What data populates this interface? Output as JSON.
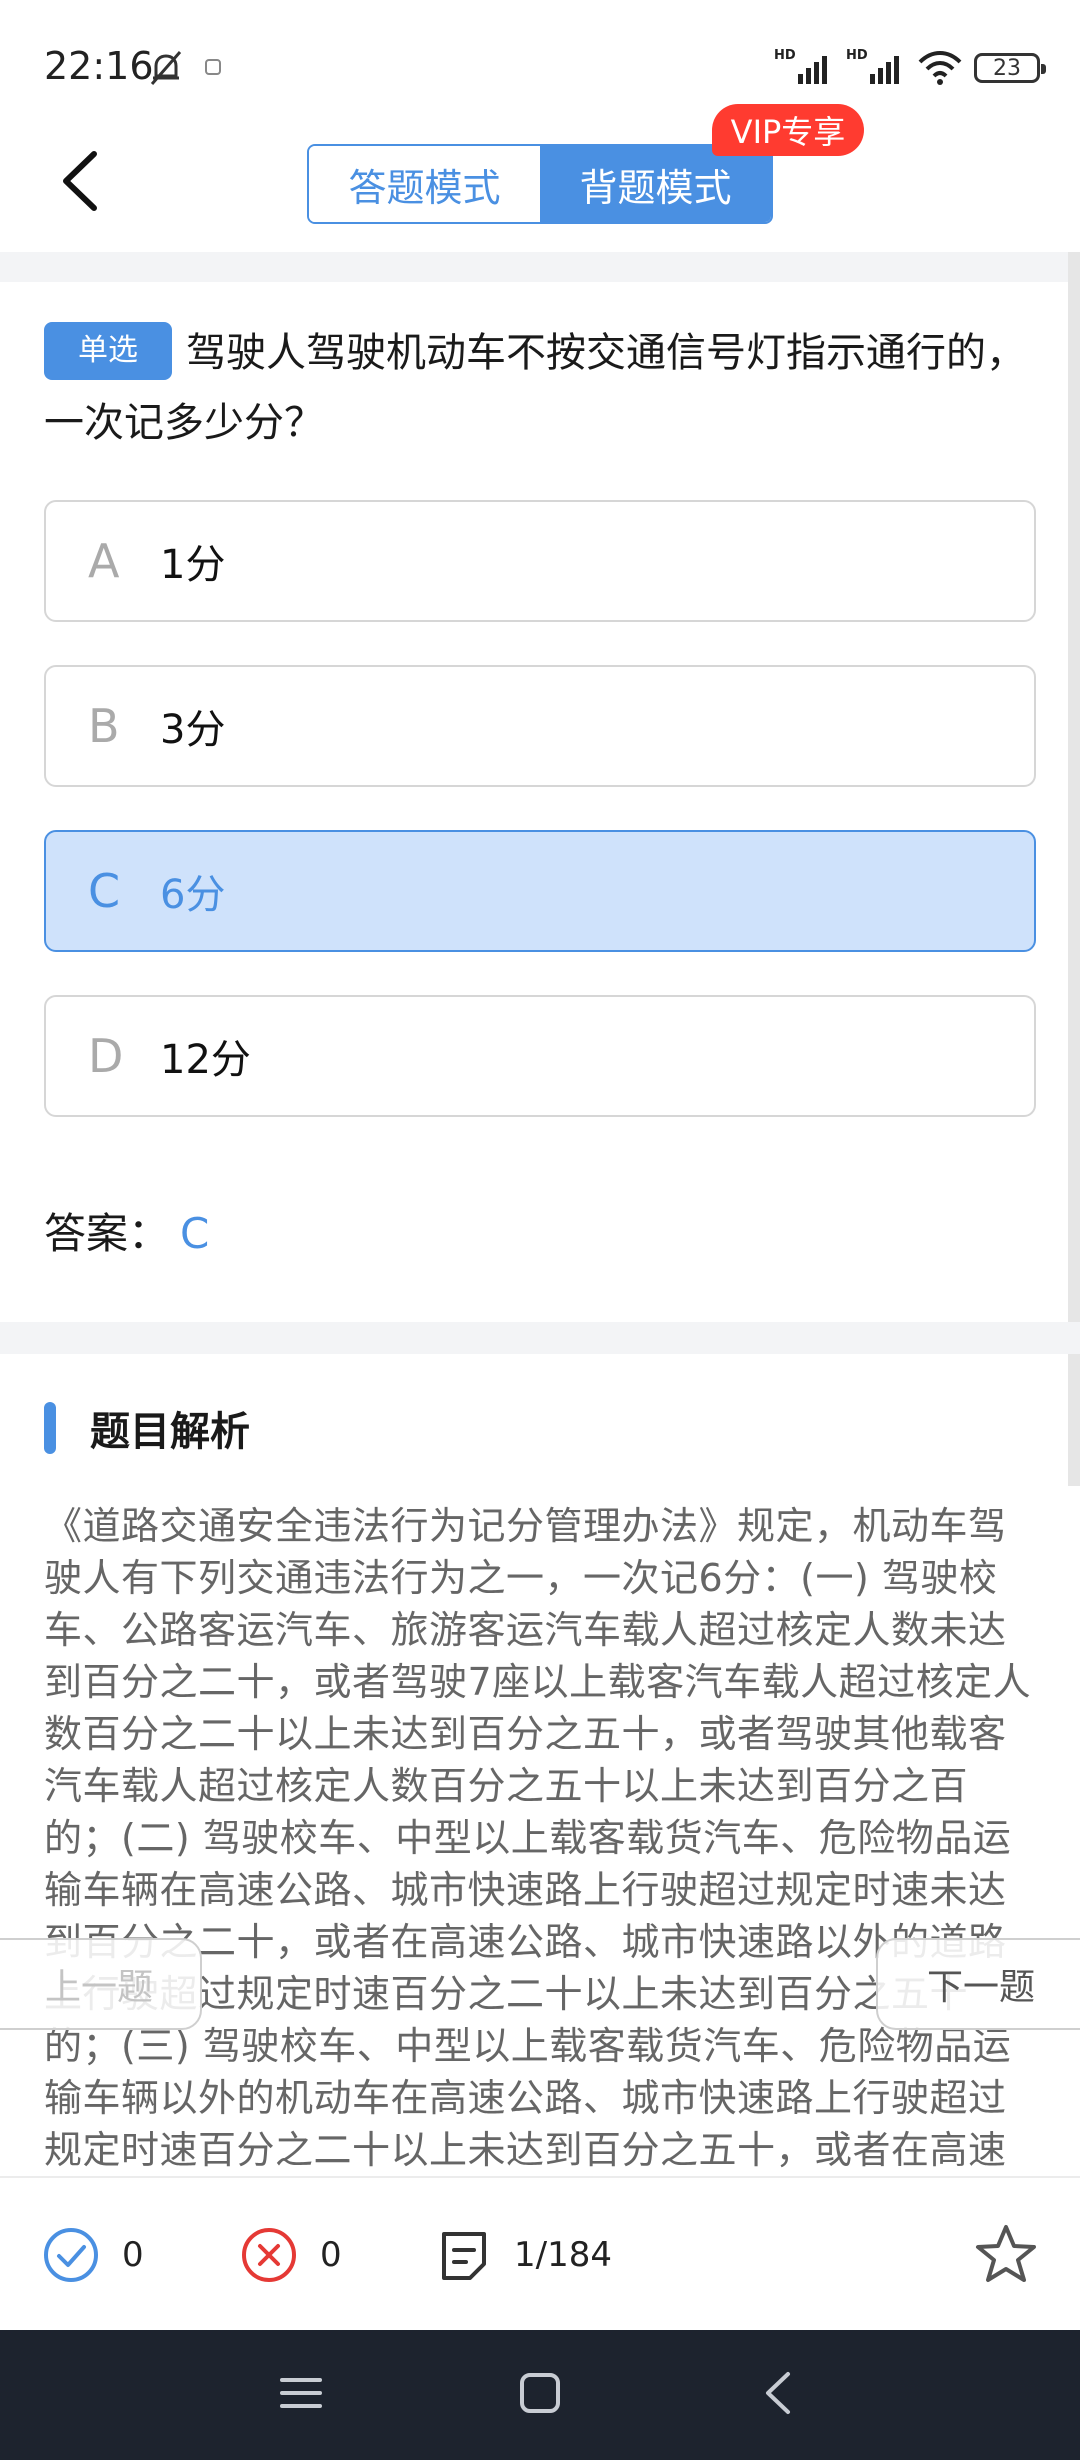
{
  "status_bar": {
    "time": "22:16",
    "signal_label": "HD",
    "battery": "23"
  },
  "header": {
    "tabs": [
      {
        "label": "答题模式",
        "active": false
      },
      {
        "label": "背题模式",
        "active": true
      }
    ],
    "vip_badge": "VIP专享"
  },
  "question": {
    "type": "单选",
    "text": "驾驶人驾驶机动车不按交通信号灯指示通行的，一次记多少分？",
    "options": [
      {
        "letter": "A",
        "text": "1分",
        "selected": false
      },
      {
        "letter": "B",
        "text": "3分",
        "selected": false
      },
      {
        "letter": "C",
        "text": "6分",
        "selected": true
      },
      {
        "letter": "D",
        "text": "12分",
        "selected": false
      }
    ],
    "answer_label": "答案：",
    "answer_value": "C"
  },
  "analysis": {
    "title": "题目解析",
    "text": "《道路交通安全违法行为记分管理办法》规定，机动车驾驶人有下列交通违法行为之一，一次记6分：(一) 驾驶校车、公路客运汽车、旅游客运汽车载人超过核定人数未达到百分之二十，或者驾驶7座以上载客汽车载人超过核定人数百分之二十以上未达到百分之五十，或者驾驶其他载客汽车载人超过核定人数百分之五十以上未达到百分之百的；(二) 驾驶校车、中型以上载客载货汽车、危险物品运输车辆在高速公路、城市快速路上行驶超过规定时速未达到百分之二十，或者在高速公路、城市快速路以外的道路上行驶超过规定时速百分之二十以上未达到百分之五十的；(三) 驾驶校车、中型以上载客载货汽车、危险物品运输车辆以外的机动车在高速公路、城市快速路上行驶超过规定时速百分之二十以上未达到百分之五十，或者在高速公路"
  },
  "navigation": {
    "prev_label": "上一题",
    "next_label": "下一题"
  },
  "bottom_bar": {
    "correct_count": "0",
    "wrong_count": "0",
    "progress": "1/184"
  },
  "colors": {
    "accent": "#4a90e2",
    "vip": "#ff3b30",
    "wrong": "#e53935",
    "sys_nav": "#1d232e"
  }
}
